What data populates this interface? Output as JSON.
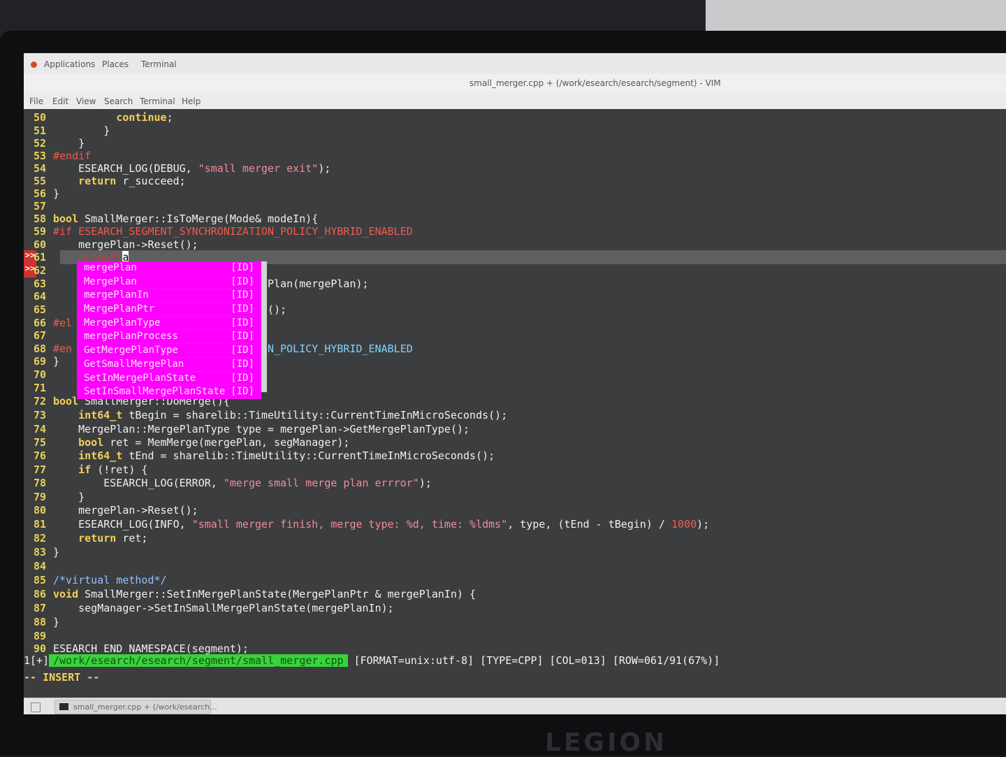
{
  "panel": {
    "applications": "Applications",
    "places": "Places",
    "terminal": "Terminal"
  },
  "window": {
    "title": "small_merger.cpp + (/work/esearch/esearch/segment) - VIM"
  },
  "menu": [
    "File",
    "Edit",
    "View",
    "Search",
    "Terminal",
    "Help"
  ],
  "code": {
    "l50": {
      "num": "50",
      "kw": "continue",
      "rest": ";"
    },
    "l51": {
      "num": "51",
      "text": "}"
    },
    "l52": {
      "num": "52",
      "text": "}"
    },
    "l53": {
      "num": "53",
      "pp": "#endif"
    },
    "l54": {
      "num": "54",
      "pre": "ESEARCH_LOG(DEBUG, ",
      "str": "\"small merger exit\"",
      "post": ");"
    },
    "l55": {
      "num": "55",
      "kw": "return",
      "rest": " r_succeed;"
    },
    "l56": {
      "num": "56",
      "text": "}"
    },
    "l57": {
      "num": "57"
    },
    "l58": {
      "num": "58",
      "ty": "bool",
      "rest": " SmallMerger::IsToMerge(Mode& modeIn){"
    },
    "l59": {
      "num": "59",
      "pp": "#if ESEARCH_SEGMENT_SYNCHRONIZATION_POLICY_HYBRID_ENABLED"
    },
    "l60": {
      "num": "60",
      "text": "mergePlan->Reset();"
    },
    "l61": {
      "num": "61",
      "typed": "mergePl",
      "cursor": "a"
    },
    "l62": {
      "num": "62"
    },
    "l63": {
      "num": "63",
      "tail": "lMergePlan(mergePlan);"
    },
    "l64": {
      "num": "64"
    },
    "l65": {
      "num": "65",
      "tail": "idPlan();"
    },
    "l66": {
      "num": "66",
      "pp": "#el"
    },
    "l67": {
      "num": "67"
    },
    "l68": {
      "num": "68",
      "pp": "#en",
      "tail": "IZATION_POLICY_HYBRID_ENABLED"
    },
    "l69": {
      "num": "69",
      "text": "}"
    },
    "l70": {
      "num": "70"
    },
    "l71": {
      "num": "71"
    },
    "l72": {
      "num": "72",
      "ty": "bool",
      "rest": " SmallMerger::DoMerge(){"
    },
    "l73": {
      "num": "73",
      "ty": "int64_t",
      "rest": " tBegin = sharelib::TimeUtility::CurrentTimeInMicroSeconds();"
    },
    "l74": {
      "num": "74",
      "text": "MergePlan::MergePlanType type = mergePlan->GetMergePlanType();"
    },
    "l75": {
      "num": "75",
      "ty": "bool",
      "rest": " ret = MemMerge(mergePlan, segManager);"
    },
    "l76": {
      "num": "76",
      "ty": "int64_t",
      "rest": " tEnd = sharelib::TimeUtility::CurrentTimeInMicroSeconds();"
    },
    "l77": {
      "num": "77",
      "kw": "if",
      "rest": " (!ret) {"
    },
    "l78": {
      "num": "78",
      "pre": "ESEARCH_LOG(ERROR, ",
      "str": "\"merge small merge plan errror\"",
      "post": ");"
    },
    "l79": {
      "num": "79",
      "text": "}"
    },
    "l80": {
      "num": "80",
      "text": "mergePlan->Reset();"
    },
    "l81": {
      "num": "81",
      "pre": "ESEARCH_LOG(INFO, ",
      "str": "\"small merger finish, merge type: %d, time: %ldms\"",
      "mid": ", type, (tEnd - tBegin) / ",
      "numv": "1000",
      "post": ");"
    },
    "l82": {
      "num": "82",
      "kw": "return",
      "rest": " ret;"
    },
    "l83": {
      "num": "83",
      "text": "}"
    },
    "l84": {
      "num": "84"
    },
    "l85": {
      "num": "85",
      "cm": "/*virtual method*/"
    },
    "l86": {
      "num": "86",
      "ty": "void",
      "rest": " SmallMerger::SetInMergePlanState(MergePlanPtr & mergePlanIn) {"
    },
    "l87": {
      "num": "87",
      "text": "segManager->SetInSmallMergePlanState(mergePlanIn);"
    },
    "l88": {
      "num": "88",
      "text": "}"
    },
    "l89": {
      "num": "89"
    },
    "l90": {
      "num": "90",
      "text": "ESEARCH_END_NAMESPACE(segment);"
    }
  },
  "signs": [
    ">>",
    ">>"
  ],
  "completion": [
    {
      "word": "mergePlan",
      "kind": "[ID]"
    },
    {
      "word": "MergePlan",
      "kind": "[ID]"
    },
    {
      "word": "mergePlanIn",
      "kind": "[ID]"
    },
    {
      "word": "MergePlanPtr",
      "kind": "[ID]"
    },
    {
      "word": "MergePlanType",
      "kind": "[ID]"
    },
    {
      "word": "mergePlanProcess",
      "kind": "[ID]"
    },
    {
      "word": "GetMergePlanType",
      "kind": "[ID]"
    },
    {
      "word": "GetSmallMergePlan",
      "kind": "[ID]"
    },
    {
      "word": "SetInMergePlanState",
      "kind": "[ID]"
    },
    {
      "word": "SetInSmallMergePlanState",
      "kind": "[ID]"
    }
  ],
  "status": {
    "buf": "1[+]",
    "path": "/work/esearch/esearch/segment/small_merger.cpp",
    "info": "[FORMAT=unix:utf-8] [TYPE=CPP] [COL=013] [ROW=061/91(67%)]"
  },
  "mode": "-- INSERT --",
  "taskbar": {
    "task": "small_merger.cpp + (/work/esearch..."
  },
  "brand": "LEGION",
  "colors": {
    "popup": "#ff00ff",
    "status_path": "#37d43a",
    "line_number": "#e8d25a",
    "sign": "#d0312d"
  }
}
